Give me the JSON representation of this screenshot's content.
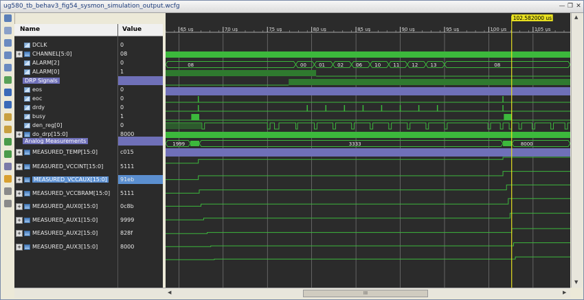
{
  "window": {
    "title": "ug580_tb_behav3_fig54_sysmon_simulation_output.wcfg"
  },
  "columns": {
    "name": "Name",
    "value": "Value"
  },
  "cursor": {
    "label": "102.582000 us",
    "time_us": 102.582
  },
  "timeline": {
    "start_us": 63.5,
    "end_us": 109.2,
    "ticks": [
      {
        "t": 65,
        "label": "65 us"
      },
      {
        "t": 70,
        "label": "70 us"
      },
      {
        "t": 75,
        "label": "75 us"
      },
      {
        "t": 80,
        "label": "80 us"
      },
      {
        "t": 85,
        "label": "85 us"
      },
      {
        "t": 90,
        "label": "90 us"
      },
      {
        "t": 95,
        "label": "95 us"
      },
      {
        "t": 100,
        "label": "100 us"
      },
      {
        "t": 105,
        "label": "105 us"
      }
    ]
  },
  "signals": [
    {
      "name": "DCLK",
      "value": "0",
      "kind": "bit",
      "expand": false
    },
    {
      "name": "CHANNEL[5:0]",
      "value": "08",
      "kind": "bus",
      "expand": true
    },
    {
      "name": "ALARM[2]",
      "value": "0",
      "kind": "bit",
      "expand": false
    },
    {
      "name": "ALARM[0]",
      "value": "1",
      "kind": "bit",
      "expand": false
    },
    {
      "name": "DRP Signals",
      "value": "",
      "kind": "group",
      "expand": false
    },
    {
      "name": "eos",
      "value": "0",
      "kind": "bit",
      "expand": false
    },
    {
      "name": "eoc",
      "value": "0",
      "kind": "bit",
      "expand": false
    },
    {
      "name": "drdy",
      "value": "0",
      "kind": "bit",
      "expand": false
    },
    {
      "name": "busy",
      "value": "1",
      "kind": "bit",
      "expand": false
    },
    {
      "name": "den_reg[0]",
      "value": "0",
      "kind": "bit",
      "expand": false
    },
    {
      "name": "do_drp[15:0]",
      "value": "8000",
      "kind": "bus",
      "expand": true
    },
    {
      "name": "Analog Measurements",
      "value": "",
      "kind": "group",
      "expand": false
    },
    {
      "name": "MEASURED_TEMP[15:0]",
      "value": "c015",
      "kind": "bus",
      "expand": true
    },
    {
      "name": "MEASURED_VCCINT[15:0]",
      "value": "5111",
      "kind": "bus",
      "expand": true
    },
    {
      "name": "MEASURED_VCCAUX[15:0]",
      "value": "91eb",
      "kind": "bus",
      "expand": true,
      "selected": true
    },
    {
      "name": "MEASURED_VCCBRAM[15:0]",
      "value": "5111",
      "kind": "bus",
      "expand": true
    },
    {
      "name": "MEASURED_AUX0[15:0]",
      "value": "0c8b",
      "kind": "bus",
      "expand": true
    },
    {
      "name": "MEASURED_AUX1[15:0]",
      "value": "9999",
      "kind": "bus",
      "expand": true
    },
    {
      "name": "MEASURED_AUX2[15:0]",
      "value": "828f",
      "kind": "bus",
      "expand": true
    },
    {
      "name": "MEASURED_AUX3[15:0]",
      "value": "8000",
      "kind": "bus",
      "expand": true
    }
  ],
  "bus_labels": {
    "channel": [
      {
        "t": 66.0,
        "text": "08"
      },
      {
        "t": 78.4,
        "text": "00"
      },
      {
        "t": 80.5,
        "text": "01"
      },
      {
        "t": 82.6,
        "text": "02"
      },
      {
        "t": 84.7,
        "text": "06"
      },
      {
        "t": 86.8,
        "text": "10"
      },
      {
        "t": 88.9,
        "text": "11"
      },
      {
        "t": 91.0,
        "text": "12"
      },
      {
        "t": 93.1,
        "text": "13"
      },
      {
        "t": 100.3,
        "text": "08"
      }
    ],
    "do_drp": [
      {
        "t": 64.3,
        "text": "1999"
      },
      {
        "t": 84.2,
        "text": "3333"
      },
      {
        "t": 103.6,
        "text": "8000"
      }
    ]
  },
  "colors": {
    "wave": "#3cb83c",
    "wave_dark": "#2f7a2f",
    "group": "#6f70b8",
    "cursor": "#e8e020",
    "grid": "#8a8a8a",
    "background": "#2b2b2b"
  },
  "scroll": {
    "hthumb": "III"
  }
}
